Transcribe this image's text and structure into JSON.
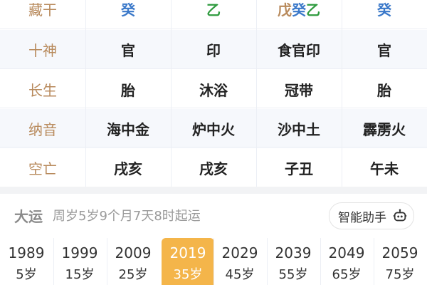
{
  "table": {
    "rows": [
      {
        "label": "藏干",
        "cells": [
          {
            "text": "癸",
            "color": "#3a78c9"
          },
          {
            "text": "乙",
            "color": "#2f9b3f"
          },
          {
            "parts": [
              {
                "text": "戊",
                "color": "#b88a5c"
              },
              {
                "text": "癸",
                "color": "#3a78c9"
              },
              {
                "text": "乙",
                "color": "#2f9b3f"
              }
            ]
          },
          {
            "text": "癸",
            "color": "#3a78c9"
          }
        ]
      },
      {
        "label": "十神",
        "cells": [
          {
            "text": "官"
          },
          {
            "text": "印"
          },
          {
            "text": "食官印"
          },
          {
            "text": "官"
          }
        ]
      },
      {
        "label": "长生",
        "cells": [
          {
            "text": "胎"
          },
          {
            "text": "沐浴"
          },
          {
            "text": "冠带"
          },
          {
            "text": "胎"
          }
        ]
      },
      {
        "label": "纳音",
        "cells": [
          {
            "text": "海中金"
          },
          {
            "text": "炉中火"
          },
          {
            "text": "沙中土"
          },
          {
            "text": "霹雳火"
          }
        ]
      },
      {
        "label": "空亡",
        "cells": [
          {
            "text": "戌亥"
          },
          {
            "text": "戌亥"
          },
          {
            "text": "子丑"
          },
          {
            "text": "午未"
          }
        ]
      }
    ]
  },
  "dayun": {
    "title": "大运",
    "subtitle": "周岁5岁9个月7天8时起运",
    "assistant_label": "智能助手",
    "assistant_icon": "robot-icon",
    "active_index": 3,
    "items": [
      {
        "year": "1989",
        "age": "5岁"
      },
      {
        "year": "1999",
        "age": "15岁"
      },
      {
        "year": "2009",
        "age": "25岁"
      },
      {
        "year": "2019",
        "age": "35岁"
      },
      {
        "year": "2029",
        "age": "45岁"
      },
      {
        "year": "2039",
        "age": "55岁"
      },
      {
        "year": "2049",
        "age": "65岁"
      },
      {
        "year": "2059",
        "age": "75岁"
      }
    ]
  },
  "colors": {
    "label": "#b88a5c",
    "active": "#f4b54a"
  }
}
